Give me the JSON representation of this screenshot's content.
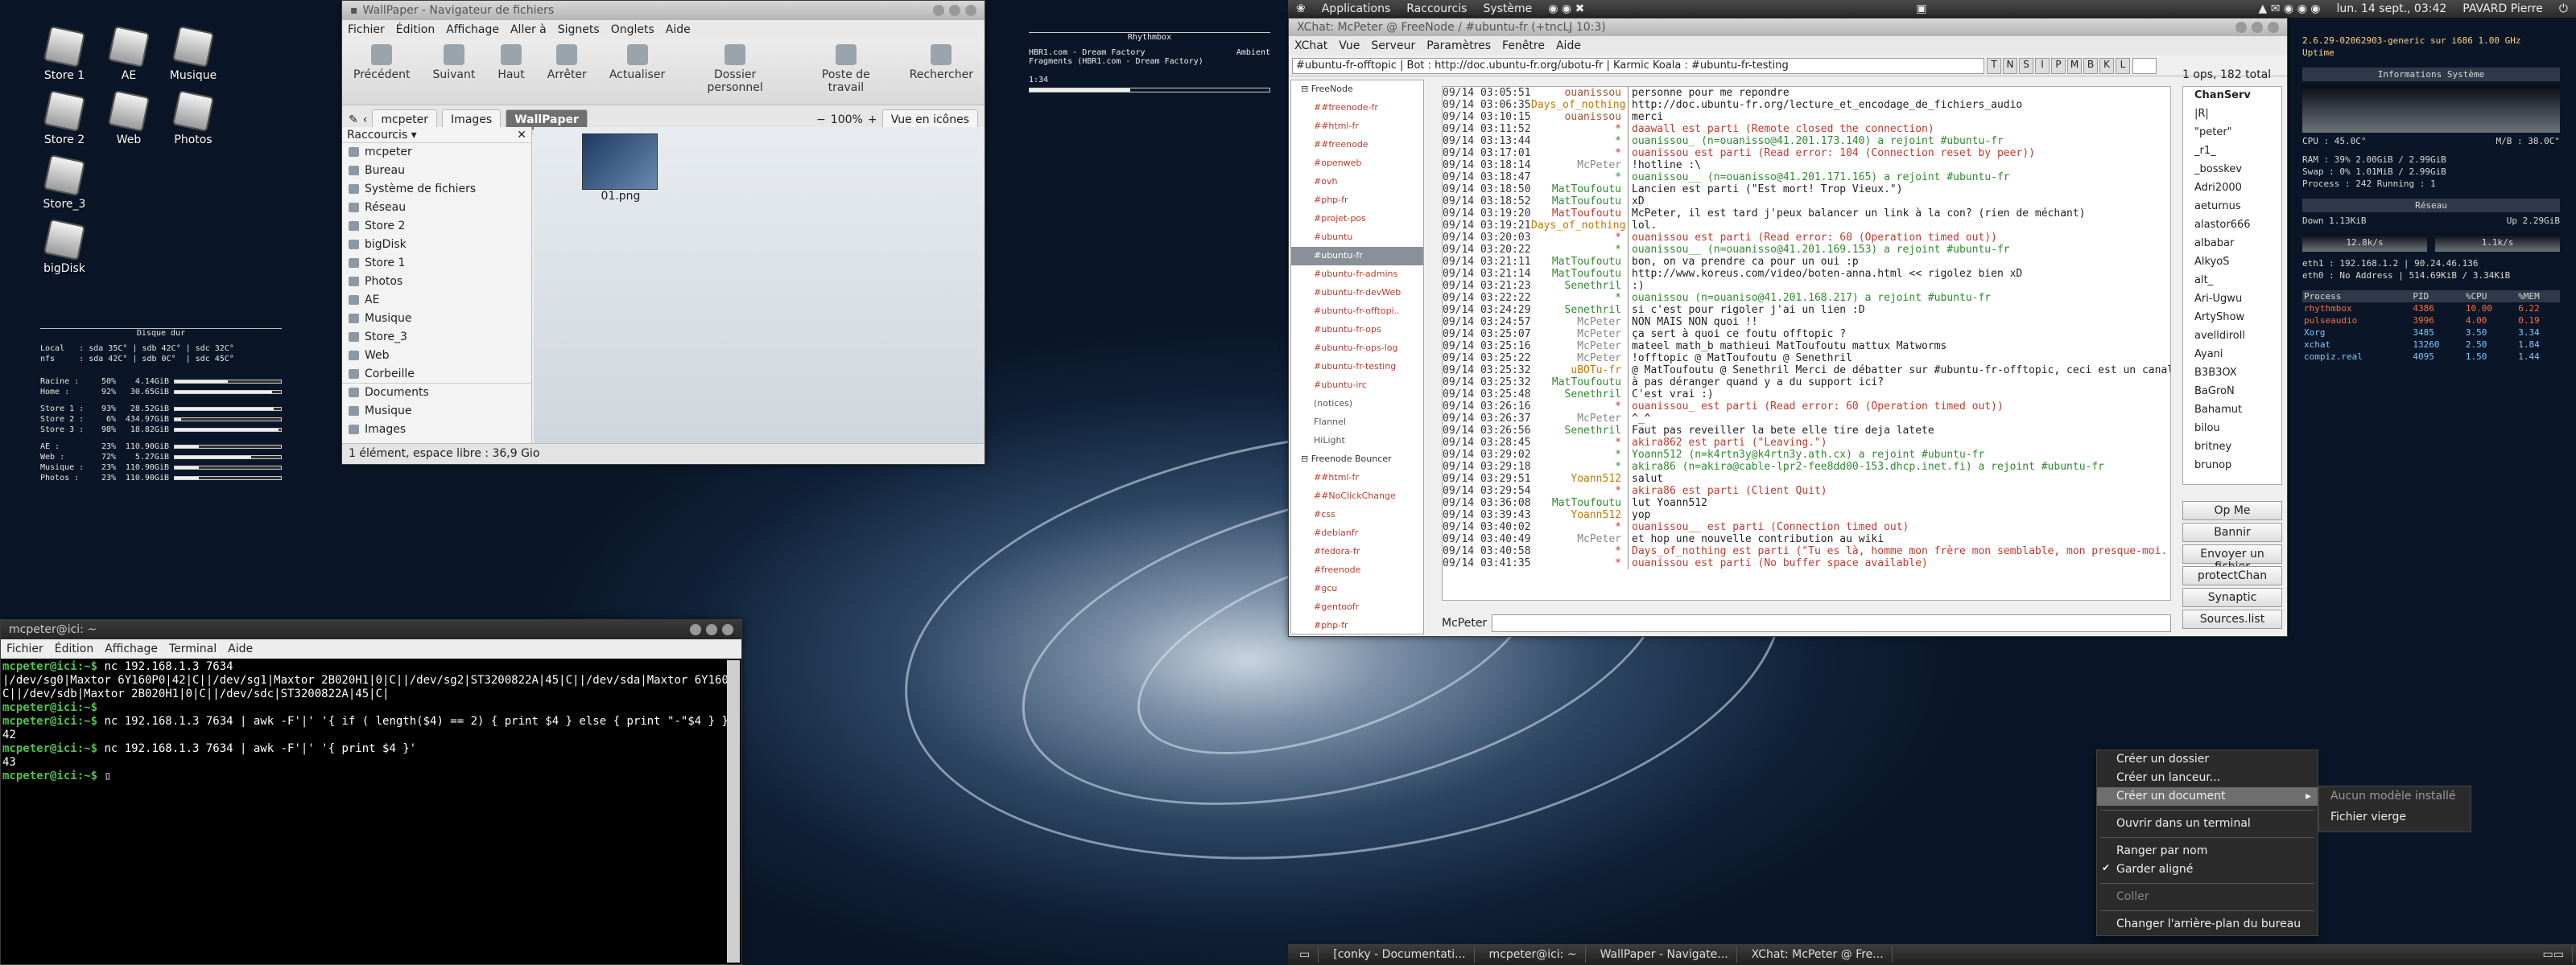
{
  "desktop": {
    "icons": [
      {
        "label": "Store 1"
      },
      {
        "label": "AE"
      },
      {
        "label": "Musique"
      },
      {
        "label": "Store 2"
      },
      {
        "label": "Web"
      },
      {
        "label": "Photos"
      },
      {
        "label": "Store_3"
      },
      {
        "label": "bigDisk"
      }
    ]
  },
  "conky_disk": {
    "title": "Disque dur",
    "temps": [
      "Local   : sda 35C° | sdb 42C° | sdc 32C°",
      "nfs     : sda 42C° | sdb 0C°  | sdc 45C°"
    ],
    "rows": [
      {
        "name": "Racine :",
        "pct": "50%",
        "size": "4.14GiB",
        "fill": 50
      },
      {
        "name": "Home   :",
        "pct": "92%",
        "size": "30.65GiB",
        "fill": 92
      },
      {
        "name": "Store 1 :",
        "pct": "93%",
        "size": "28.52GiB",
        "fill": 93
      },
      {
        "name": "Store 2 :",
        "pct": "6%",
        "size": "434.97GiB",
        "fill": 6
      },
      {
        "name": "Store 3 :",
        "pct": "98%",
        "size": "18.82GiB",
        "fill": 98
      },
      {
        "name": "AE      :",
        "pct": "23%",
        "size": "110.90GiB",
        "fill": 23
      },
      {
        "name": "Web     :",
        "pct": "72%",
        "size": "5.27GiB",
        "fill": 72
      },
      {
        "name": "Musique :",
        "pct": "23%",
        "size": "110.90GiB",
        "fill": 23
      },
      {
        "name": "Photos  :",
        "pct": "23%",
        "size": "110.90GiB",
        "fill": 23
      }
    ]
  },
  "top_panel": {
    "menus": [
      "Applications",
      "Raccourcis",
      "Système"
    ],
    "clock": "lun. 14 sept., 03:42",
    "user": "PAVARD Pierre"
  },
  "nautilus": {
    "title": "WallPaper - Navigateur de fichiers",
    "menus": [
      "Fichier",
      "Édition",
      "Affichage",
      "Aller à",
      "Signets",
      "Onglets",
      "Aide"
    ],
    "tools": [
      "Précédent",
      "Suivant",
      "Haut",
      "Arrêter",
      "Actualiser",
      "Dossier personnel",
      "Poste de travail",
      "Rechercher"
    ],
    "crumbs": [
      "mcpeter",
      "Images",
      "WallPaper"
    ],
    "zoom": "100%",
    "view": "Vue en icônes",
    "side_header": "Raccourcis",
    "side": [
      "mcpeter",
      "Bureau",
      "Système de fichiers",
      "Réseau",
      "Store 2",
      "bigDisk",
      "Store 1",
      "Photos",
      "AE",
      "Musique",
      "Store_3",
      "Web",
      "Corbeille",
      "Documents",
      "Musique",
      "Images"
    ],
    "file": "01.png",
    "status": "1 élément, espace libre : 36,9 Gio"
  },
  "rhythmbox": {
    "title": "Rhythmbox",
    "line1": "HBR1.com - Dream Factory",
    "genre": "Ambient",
    "line2": "Fragments (HBR1.com - Dream Factory)",
    "time": "1:34",
    "progress": 0.42
  },
  "xchat": {
    "title": "XChat: McPeter @ FreeNode / #ubuntu-fr (+tncLJ 10:3)",
    "menus": [
      "XChat",
      "Vue",
      "Serveur",
      "Paramètres",
      "Fenêtre",
      "Aide"
    ],
    "topic": "#ubuntu-fr-offtopic | Bot : http://doc.ubuntu-fr.org/ubotu-fr | Karmic Koala : #ubuntu-fr-testing",
    "modes": [
      "T",
      "N",
      "S",
      "I",
      "P",
      "M",
      "B",
      "K",
      "L"
    ],
    "count": "1 ops, 182 total",
    "tree": [
      {
        "t": "FreeNode",
        "k": "net"
      },
      {
        "t": "##freenode-fr"
      },
      {
        "t": "##html-fr"
      },
      {
        "t": "##freenode"
      },
      {
        "t": "#openweb"
      },
      {
        "t": "#ovh"
      },
      {
        "t": "#php-fr"
      },
      {
        "t": "#projet-pos"
      },
      {
        "t": "#ubuntu"
      },
      {
        "t": "#ubuntu-fr",
        "k": "sel"
      },
      {
        "t": "#ubuntu-fr-admins"
      },
      {
        "t": "#ubuntu-fr-devWeb"
      },
      {
        "t": "#ubuntu-fr-offtopi.."
      },
      {
        "t": "#ubuntu-fr-ops"
      },
      {
        "t": "#ubuntu-fr-ops-log"
      },
      {
        "t": "#ubuntu-fr-testing"
      },
      {
        "t": "#ubuntu-irc"
      },
      {
        "t": "(notices)",
        "k": "plain"
      },
      {
        "t": "Flannel",
        "k": "plain"
      },
      {
        "t": "HiLight",
        "k": "plain"
      },
      {
        "t": "Freenode Bouncer",
        "k": "net"
      },
      {
        "t": "##html-fr"
      },
      {
        "t": "##NoClickChange"
      },
      {
        "t": "#css"
      },
      {
        "t": "#debianfr"
      },
      {
        "t": "#fedora-fr"
      },
      {
        "t": "#freenode"
      },
      {
        "t": "#gcu"
      },
      {
        "t": "#gentoofr"
      },
      {
        "t": "#php-fr"
      },
      {
        "t": "#ubuntu"
      }
    ],
    "lines": [
      {
        "t": "09/14 03:05:51",
        "n": "ouanissou",
        "m": "personne pour me repondre",
        "c": "#a0522d"
      },
      {
        "t": "09/14 03:06:35",
        "n": "Days_of_nothing",
        "m": "http://doc.ubuntu-fr.org/lecture_et_encodage_de_fichiers_audio",
        "c": "#c07800"
      },
      {
        "t": "09/14 03:10:15",
        "n": "ouanissou",
        "m": "merci",
        "c": "#a0522d"
      },
      {
        "t": "09/14 03:11:52",
        "n": "*",
        "m": "daawall est parti (Remote closed the connection)",
        "c": "#c0392b"
      },
      {
        "t": "09/14 03:13:44",
        "n": "*",
        "m": "ouanissou_ (n=ouanisso@41.201.173.140) a rejoint #ubuntu-fr",
        "c": "#2e8b2e"
      },
      {
        "t": "09/14 03:17:01",
        "n": "*",
        "m": "ouanissou est parti (Read error: 104 (Connection reset by peer))",
        "c": "#c0392b"
      },
      {
        "t": "09/14 03:18:14",
        "n": "McPeter",
        "m": "!hotline :\\",
        "c": "#888"
      },
      {
        "t": "09/14 03:18:47",
        "n": "*",
        "m": "ouanissou__ (n=ouanisso@41.201.171.165) a rejoint #ubuntu-fr",
        "c": "#2e8b2e"
      },
      {
        "t": "09/14 03:18:50",
        "n": "MatToufoutu",
        "m": "Lancien est parti (\"Est mort! Trop Vieux.\")",
        "c": "#2e8b2e"
      },
      {
        "t": "09/14 03:18:52",
        "n": "MatToufoutu",
        "m": "xD",
        "c": "#2e8b2e"
      },
      {
        "t": "09/14 03:19:20",
        "n": "MatToufoutu",
        "m": "McPeter, il est tard j'peux balancer un link à la con? (rien de méchant)",
        "c": "#c0392b"
      },
      {
        "t": "09/14 03:19:21",
        "n": "Days_of_nothing",
        "m": "lol.",
        "c": "#c07800"
      },
      {
        "t": "09/14 03:20:03",
        "n": "*",
        "m": "ouanissou est parti (Read error: 60 (Operation timed out))",
        "c": "#c0392b"
      },
      {
        "t": "09/14 03:20:22",
        "n": "*",
        "m": "ouanissou__ (n=ouanisso@41.201.169.153) a rejoint #ubuntu-fr",
        "c": "#2e8b2e"
      },
      {
        "t": "09/14 03:21:11",
        "n": "MatToufoutu",
        "m": "bon, on va prendre ca pour un oui :p",
        "c": "#2e8b2e"
      },
      {
        "t": "09/14 03:21:14",
        "n": "MatToufoutu",
        "m": "http://www.koreus.com/video/boten-anna.html << rigolez bien xD",
        "c": "#2e8b2e"
      },
      {
        "t": "09/14 03:21:23",
        "n": "Senethril",
        "m": ":)",
        "c": "#2e8b2e"
      },
      {
        "t": "09/14 03:22:22",
        "n": "*",
        "m": "ouanissou (n=ouaniso@41.201.168.217) a rejoint #ubuntu-fr",
        "c": "#2e8b2e"
      },
      {
        "t": "09/14 03:24:29",
        "n": "Senethril",
        "m": "si c'est pour rigoler j'ai un lien :D",
        "c": "#2e8b2e"
      },
      {
        "t": "09/14 03:24:57",
        "n": "McPeter",
        "m": "NON MAIS NON quoi !!",
        "c": "#888"
      },
      {
        "t": "09/14 03:25:07",
        "n": "McPeter",
        "m": "ça sert à quoi ce foutu offtopic ?",
        "c": "#888"
      },
      {
        "t": "09/14 03:25:16",
        "n": "McPeter",
        "m": "mateel math_b mathieui MatToufoutu mattux Matworms",
        "c": "#888"
      },
      {
        "t": "09/14 03:25:22",
        "n": "McPeter",
        "m": "!offtopic @ MatToufoutu @ Senethril",
        "c": "#888"
      },
      {
        "t": "09/14 03:25:32",
        "n": "uBOTu-fr",
        "m": "@ MatToufoutu @ Senethril Merci de débatter sur #ubuntu-fr-offtopic, ceci est un canal de support.",
        "c": "#c07800"
      },
      {
        "t": "09/14 03:25:32",
        "n": "MatToufoutu",
        "m": "à pas déranger quand y a du support ici?",
        "c": "#2e8b2e"
      },
      {
        "t": "09/14 03:25:48",
        "n": "Senethril",
        "m": "C'est vrai :)",
        "c": "#2e8b2e"
      },
      {
        "t": "09/14 03:26:16",
        "n": "*",
        "m": "ouanissou_ est parti (Read error: 60 (Operation timed out))",
        "c": "#c0392b"
      },
      {
        "t": "09/14 03:26:37",
        "n": "McPeter",
        "m": "^_^",
        "c": "#888"
      },
      {
        "t": "09/14 03:26:56",
        "n": "Senethril",
        "m": "Faut pas reveiller la bete elle tire deja latete",
        "c": "#2e8b2e"
      },
      {
        "t": "09/14 03:28:45",
        "n": "*",
        "m": "akira862 est parti (\"Leaving.\")",
        "c": "#c0392b"
      },
      {
        "t": "09/14 03:29:02",
        "n": "*",
        "m": "Yoann512 (n=k4rtn3y@k4rtn3y.ath.cx) a rejoint #ubuntu-fr",
        "c": "#2e8b2e"
      },
      {
        "t": "09/14 03:29:18",
        "n": "*",
        "m": "akira86 (n=akira@cable-lpr2-fee8dd00-153.dhcp.inet.fi) a rejoint #ubuntu-fr",
        "c": "#2e8b2e"
      },
      {
        "t": "09/14 03:29:51",
        "n": "Yoann512",
        "m": "salut",
        "c": "#c07800"
      },
      {
        "t": "09/14 03:29:54",
        "n": "*",
        "m": "akira86 est parti (Client Quit)",
        "c": "#c0392b"
      },
      {
        "t": "09/14 03:36:08",
        "n": "MatToufoutu",
        "m": "lut Yoann512",
        "c": "#2e8b2e"
      },
      {
        "t": "09/14 03:39:43",
        "n": "Yoann512",
        "m": "yop",
        "c": "#c07800"
      },
      {
        "t": "09/14 03:40:02",
        "n": "*",
        "m": "ouanissou__ est parti (Connection timed out)",
        "c": "#c0392b"
      },
      {
        "t": "09/14 03:40:49",
        "n": "McPeter",
        "m": "et hop une nouvelle contribution au wiki",
        "c": "#888"
      },
      {
        "t": "09/14 03:40:58",
        "n": "*",
        "m": "Days_of_nothing est parti (\"Tu es là, homme mon frère mon semblable, mon presque-moi. Tu es là près de moi, je te tends les bras, je cherche la chale)",
        "c": "#c0392b"
      },
      {
        "t": "09/14 03:41:35",
        "n": "*",
        "m": "ouanissou est parti (No buffer space available)",
        "c": "#c0392b"
      }
    ],
    "nick": "McPeter",
    "users": [
      "ChanServ",
      "|R|",
      "\"peter\"",
      "_r1_",
      "_bosskev",
      "Adri2000",
      "aeturnus",
      "alastor666",
      "albabar",
      "AlkyoS",
      "alt_",
      "Ari-Ugwu",
      "ArtyShow",
      "avelldiroll",
      "Ayani",
      "B3B3OX",
      "BaGroN",
      "Bahamut",
      "bilou",
      "britney",
      "brunop"
    ],
    "buttons": [
      "Op Me",
      "Bannir",
      "Envoyer un fichier",
      "protectChan",
      "Synaptic",
      "Sources.list"
    ]
  },
  "conky_sys": {
    "kernel": "2.6.29-02062903-generic sur i686  1.00 GHz",
    "uptime": "Uptime",
    "info_title": "Informations Système",
    "cpu": "CPU : 45.0C°",
    "mb": "M/B : 38.0C°",
    "ram": "RAM   : 39%   2.00GiB / 2.99GiB",
    "swap": "Swap  :  0%   1.01MiB / 2.99GiB",
    "proc": "Process : 242          Running : 1",
    "net_title": "Réseau",
    "down": "Down      1.13KiB",
    "up": "Up      2.29GiB",
    "down_rate": "12.8k/s",
    "up_rate": "1.1k/s",
    "eth1": "eth1 :   192.168.1.2 | 90.24.46.136",
    "eth0": "eth0 :   No Address | 514.69KiB / 3.34KiB",
    "proc_head": [
      "Process",
      "PID",
      "%CPU",
      "%MEM"
    ],
    "procs": [
      {
        "name": "rhythmbox",
        "pid": "4386",
        "cpu": "10.00",
        "mem": "6.22",
        "k": "hot"
      },
      {
        "name": "pulseaudio",
        "pid": "3996",
        "cpu": "4.00",
        "mem": "0.19",
        "k": "hot"
      },
      {
        "name": "Xorg",
        "pid": "3485",
        "cpu": "3.50",
        "mem": "3.34",
        "k": "cool"
      },
      {
        "name": "xchat",
        "pid": "13260",
        "cpu": "2.50",
        "mem": "1.84",
        "k": "cool"
      },
      {
        "name": "compiz.real",
        "pid": "4095",
        "cpu": "1.50",
        "mem": "1.44",
        "k": "cool"
      }
    ]
  },
  "terminal": {
    "title": "mcpeter@ici: ~",
    "menus": [
      "Fichier",
      "Édition",
      "Affichage",
      "Terminal",
      "Aide"
    ],
    "lines": [
      {
        "p": "mcpeter@ici:~$",
        "c": " nc 192.168.1.3 7634"
      },
      {
        "p": "",
        "c": "|/dev/sg0|Maxtor 6Y160P0|42|C||/dev/sg1|Maxtor 2B020H1|0|C||/dev/sg2|ST3200822A|45|C||/dev/sda|Maxtor 6Y160P0|42|C"
      },
      {
        "p": "",
        "c": "C||/dev/sdb|Maxtor 2B020H1|0|C||/dev/sdc|ST3200822A|45|C|"
      },
      {
        "p": "mcpeter@ici:~$",
        "c": ""
      },
      {
        "p": "mcpeter@ici:~$",
        "c": " nc 192.168.1.3 7634 | awk -F'|' '{ if ( length($4) == 2) { print $4 } else { print \"-\"$4 } }'"
      },
      {
        "p": "",
        "c": "42"
      },
      {
        "p": "mcpeter@ici:~$",
        "c": " nc 192.168.1.3 7634 | awk -F'|' '{ print $4 }'"
      },
      {
        "p": "",
        "c": "43"
      },
      {
        "p": "mcpeter@ici:~$",
        "c": " "
      }
    ]
  },
  "context_menu": {
    "items": [
      {
        "t": "Créer un dossier"
      },
      {
        "t": "Créer un lanceur..."
      },
      {
        "t": "Créer un document",
        "k": "hl"
      },
      {
        "sep": true
      },
      {
        "t": "Ouvrir dans un terminal"
      },
      {
        "sep": true
      },
      {
        "t": "Ranger par nom"
      },
      {
        "t": "Garder aligné",
        "k": "chk"
      },
      {
        "sep": true
      },
      {
        "t": "Coller",
        "k": "dis"
      },
      {
        "sep": true
      },
      {
        "t": "Changer l'arrière-plan du bureau"
      }
    ],
    "sub": [
      "Aucun modèle installé",
      "Fichier vierge"
    ]
  },
  "bottom_panel": {
    "tasks": [
      "[conky - Documentati...",
      "mcpeter@ici: ~",
      "WallPaper - Navigate...",
      "XChat: McPeter @ Fre..."
    ]
  },
  "colors": {
    "accent": "#6e6e6e",
    "prompt": "#4fc24f",
    "join": "#2e8b2e",
    "part": "#c0392b"
  }
}
